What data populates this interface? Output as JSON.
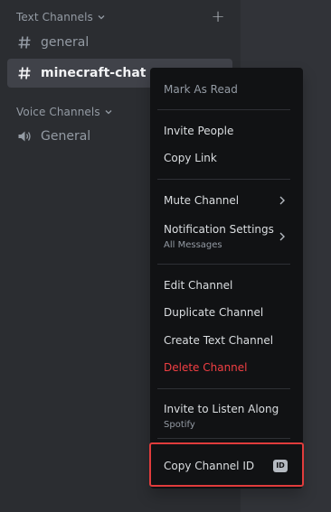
{
  "sidebar": {
    "text_category": "Text Channels",
    "voice_category": "Voice Channels",
    "channels": [
      {
        "name": "general"
      },
      {
        "name": "minecraft-chat"
      },
      {
        "name": "General"
      }
    ]
  },
  "context_menu": {
    "mark_as_read": "Mark As Read",
    "invite_people": "Invite People",
    "copy_link": "Copy Link",
    "mute_channel": "Mute Channel",
    "notification_settings": "Notification Settings",
    "notification_value": "All Messages",
    "edit_channel": "Edit Channel",
    "duplicate_channel": "Duplicate Channel",
    "create_text_channel": "Create Text Channel",
    "delete_channel": "Delete Channel",
    "invite_listen": "Invite to Listen Along",
    "invite_listen_sub": "Spotify",
    "copy_channel_id": "Copy Channel ID",
    "id_badge": "ID"
  },
  "colors": {
    "highlight": "#e03c3c",
    "danger": "#f23f43"
  }
}
